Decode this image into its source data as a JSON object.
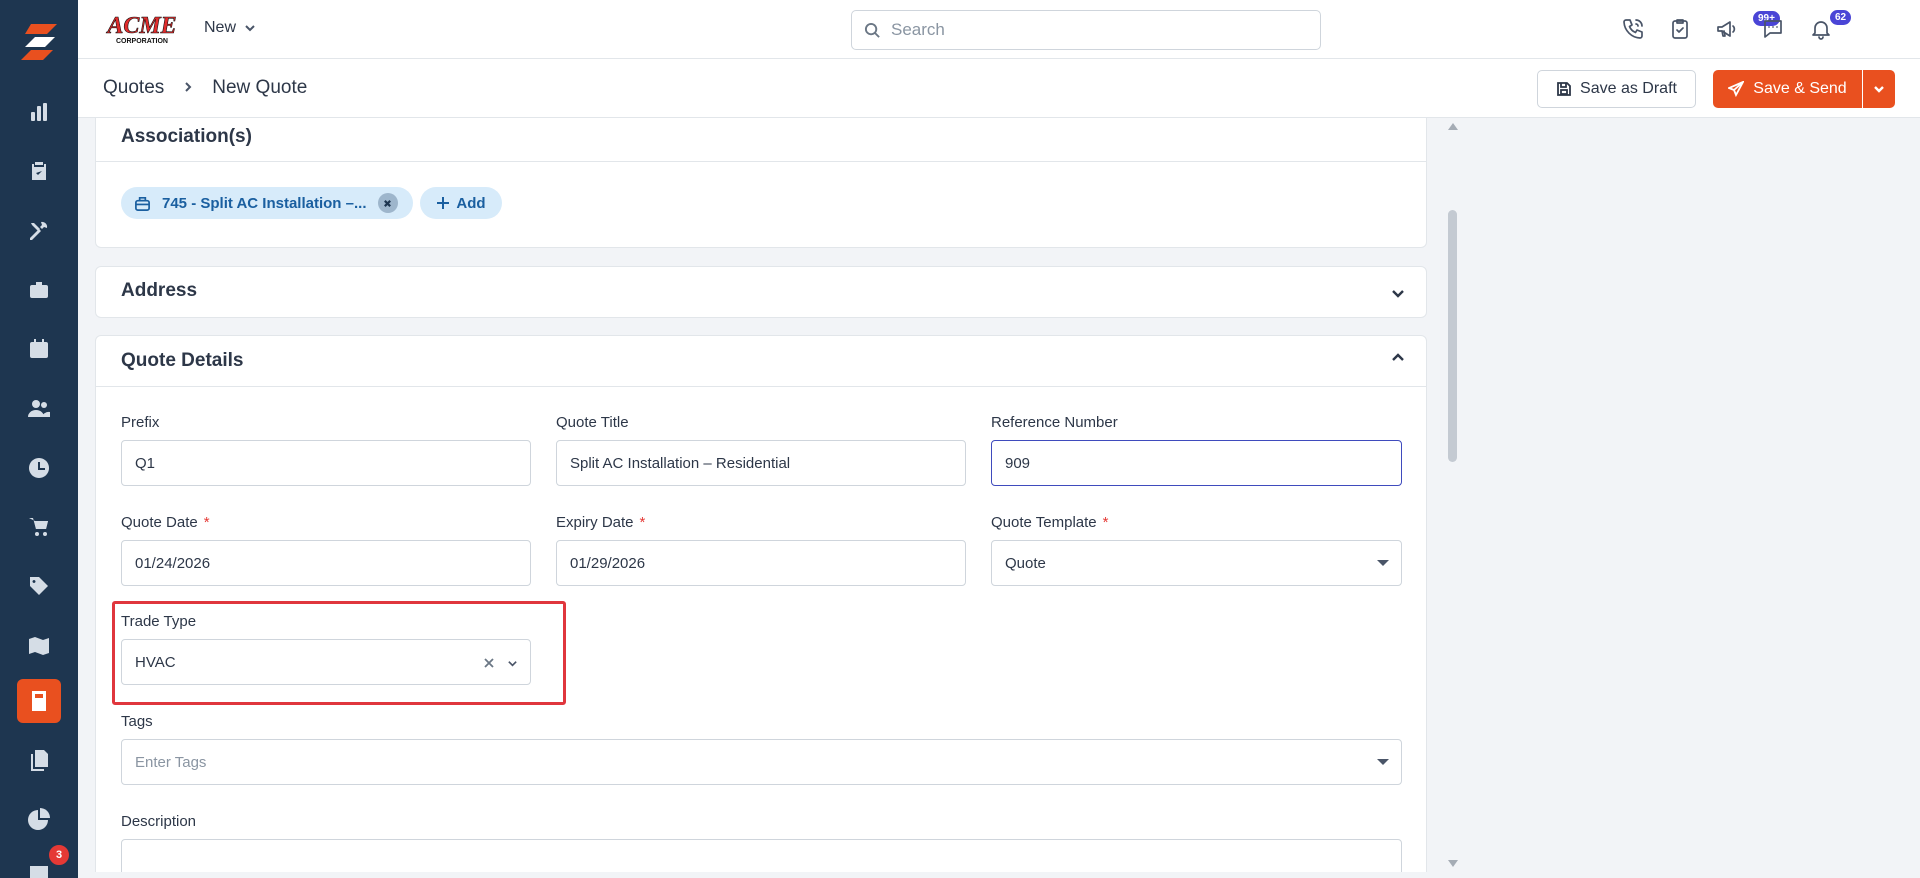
{
  "app": {
    "brand_name": "ACME",
    "brand_sub": "CORPORATION",
    "new_label": "New"
  },
  "search": {
    "placeholder": "Search"
  },
  "notifications": {
    "tasks_badge": "99+",
    "bell_badge": "62"
  },
  "sidebar": {
    "items": [
      {
        "icon": "bar-chart-icon"
      },
      {
        "icon": "clipboard-check-icon"
      },
      {
        "icon": "tools-icon"
      },
      {
        "icon": "briefcase-icon"
      },
      {
        "icon": "calendar-icon"
      },
      {
        "icon": "users-icon"
      },
      {
        "icon": "clock-icon"
      },
      {
        "icon": "cart-icon"
      },
      {
        "icon": "tag-icon"
      },
      {
        "icon": "map-icon"
      },
      {
        "icon": "calculator-icon",
        "active": true
      },
      {
        "icon": "documents-icon"
      },
      {
        "icon": "pie-chart-icon"
      },
      {
        "icon": "chat-icon"
      }
    ],
    "chat_badge": "3"
  },
  "breadcrumb": {
    "parent": "Quotes",
    "current": "New Quote"
  },
  "actions": {
    "save_draft": "Save as Draft",
    "save_send": "Save & Send"
  },
  "associations": {
    "title": "Association(s)",
    "chip_label": "745 - Split AC Installation –...",
    "add_label": "Add"
  },
  "address": {
    "title": "Address"
  },
  "quote_details": {
    "title": "Quote Details",
    "prefix": {
      "label": "Prefix",
      "value": "Q1"
    },
    "quote_title": {
      "label": "Quote Title",
      "value": "Split AC Installation – Residential"
    },
    "reference_number": {
      "label": "Reference Number",
      "value": "909"
    },
    "quote_date": {
      "label": "Quote Date",
      "value": "01/24/2026",
      "required": "*"
    },
    "expiry_date": {
      "label": "Expiry Date",
      "value": "01/29/2026",
      "required": "*"
    },
    "quote_template": {
      "label": "Quote Template",
      "value": "Quote",
      "required": "*"
    },
    "trade_type": {
      "label": "Trade Type",
      "value": "HVAC"
    },
    "tags": {
      "label": "Tags",
      "placeholder": "Enter Tags"
    },
    "description": {
      "label": "Description"
    }
  },
  "colors": {
    "accent": "#e9501f",
    "sidebar": "#1e3650",
    "chip": "#d7ebfa",
    "badge": "#4a45d6",
    "highlight": "#e0363d"
  }
}
